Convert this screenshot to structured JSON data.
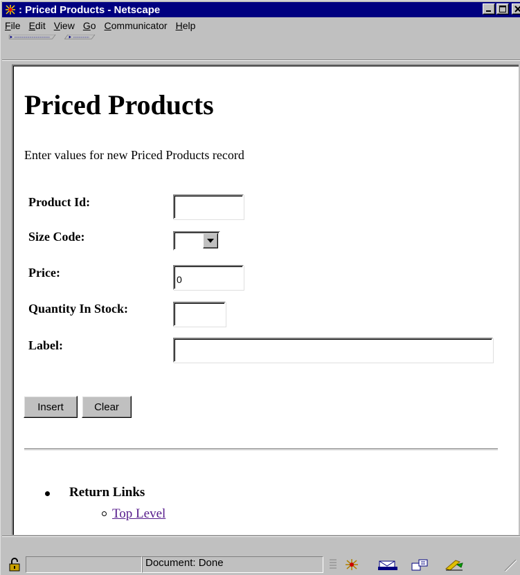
{
  "window": {
    "title": ": Priced Products - Netscape",
    "controls": [
      "minimize",
      "maximize",
      "close"
    ]
  },
  "menubar": {
    "items": [
      {
        "pre": "",
        "key": "F",
        "post": "ile"
      },
      {
        "pre": "",
        "key": "E",
        "post": "dit"
      },
      {
        "pre": "",
        "key": "V",
        "post": "iew"
      },
      {
        "pre": "",
        "key": "G",
        "post": "o"
      },
      {
        "pre": "",
        "key": "C",
        "post": "ommunicator"
      },
      {
        "pre": "",
        "key": "H",
        "post": "elp"
      }
    ]
  },
  "page": {
    "title": "Priced Products",
    "intro": "Enter values for new Priced Products record",
    "fields": {
      "product_id": {
        "label": "Product Id:",
        "value": ""
      },
      "size_code": {
        "label": "Size Code:",
        "value": ""
      },
      "price": {
        "label": "Price:",
        "value": "0"
      },
      "quantity": {
        "label": "Quantity In Stock:",
        "value": ""
      },
      "label": {
        "label": "Label:",
        "value": ""
      }
    },
    "buttons": {
      "insert": "Insert",
      "clear": "Clear"
    },
    "return_links": {
      "heading": "Return Links",
      "links": [
        "Top Level"
      ]
    }
  },
  "statusbar": {
    "text": "Document: Done",
    "icons": [
      "security-lock-icon",
      "navigator-icon",
      "mail-icon",
      "discussion-icon",
      "composer-icon"
    ]
  }
}
